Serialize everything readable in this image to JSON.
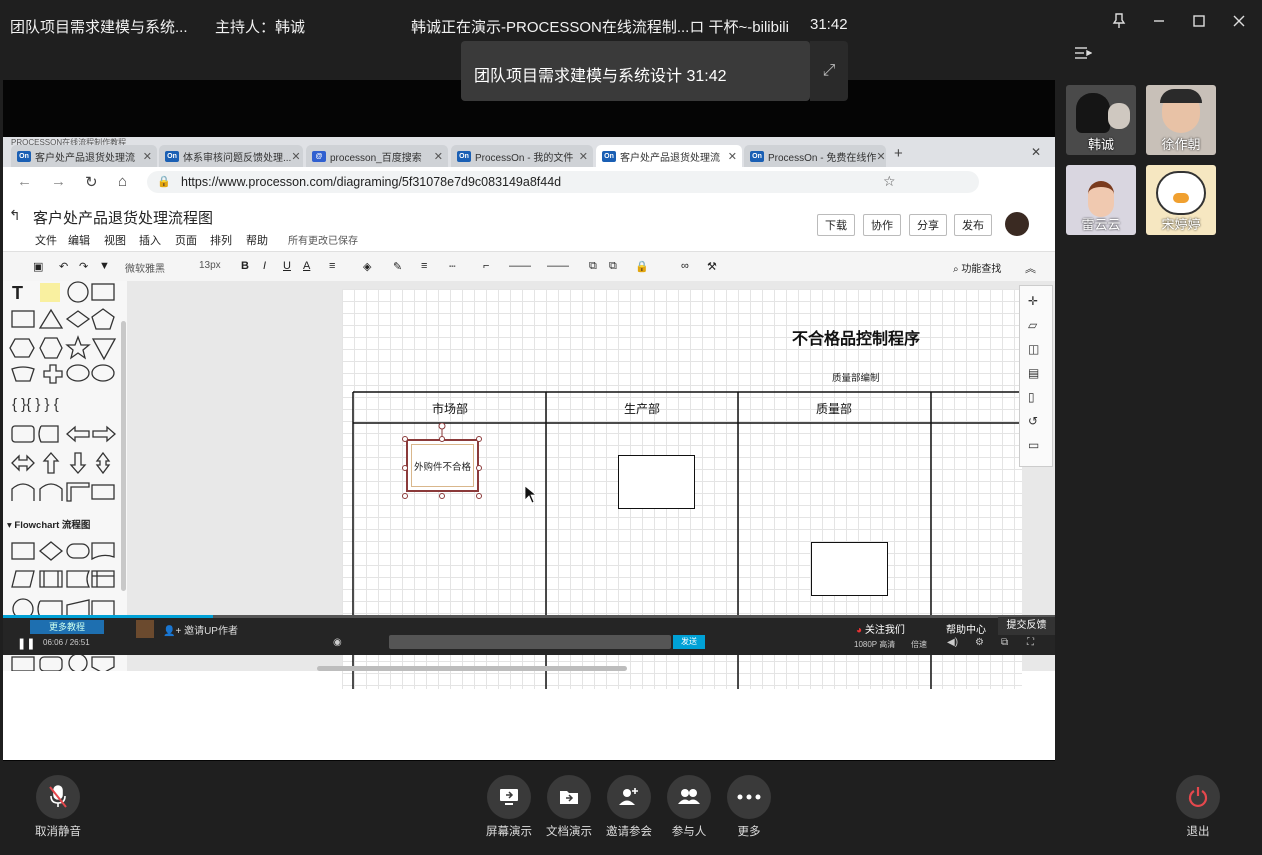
{
  "titlebar": {
    "meeting_title": "团队项目需求建模与系统...",
    "host": "主持人：韩诚",
    "presenting": "韩诚正在演示-PROCESSON在线流程制...ロ 干杯~-bilibili",
    "timer": "31:42"
  },
  "tooltip": {
    "text": "团队项目需求建模与系统设计  31:42"
  },
  "browser": {
    "window_label": "PROCESSON在线流程制作教程",
    "tabs": [
      {
        "icon": "On",
        "label": "客户处产品退货处理流"
      },
      {
        "icon": "On",
        "label": "体系审核问题反馈处理..."
      },
      {
        "icon": "@",
        "label": "processon_百度搜索"
      },
      {
        "icon": "On",
        "label": "ProcessOn - 我的文件"
      },
      {
        "icon": "On",
        "label": "客户处产品退货处理流"
      },
      {
        "icon": "On",
        "label": "ProcessOn - 免费在线作"
      }
    ],
    "url": "https://www.processon.com/diagraming/5f31078e7d9c083149a8f44d"
  },
  "app": {
    "doc_title": "客户处产品退货处理流程图",
    "menu": [
      "文件",
      "编辑",
      "视图",
      "插入",
      "页面",
      "排列",
      "帮助"
    ],
    "saved": "所有更改已保存",
    "buttons": {
      "download": "下载",
      "collab": "协作",
      "share": "分享",
      "publish": "发布"
    },
    "font": "微软雅黑",
    "size": "13px",
    "search": "功能查找",
    "flowchart_section": "Flowchart 流程图"
  },
  "diagram": {
    "title": "不合格品控制程序",
    "subtitle": "质量部编制",
    "lanes": [
      "市场部",
      "生产部",
      "质量部"
    ],
    "selected_box": "外购件不合格"
  },
  "video": {
    "progress_time": "06:06 / 26:51",
    "popup": "更多教程",
    "follow": "关注我们",
    "help": "帮助中心",
    "feedback": "提交反馈",
    "send": "发送",
    "quality": "1080P 高清",
    "speed": "倍速",
    "uploader": "邀请UP作者"
  },
  "participants": [
    {
      "name": "韩诚",
      "color": "#4a4a4a"
    },
    {
      "name": "徐作朝",
      "color": "#c8c0b8"
    },
    {
      "name": "雷云云",
      "color": "#d9d6e0"
    },
    {
      "name": "宋婷婷",
      "color": "#f6e7c1"
    }
  ],
  "controls": {
    "mute": "取消静音",
    "screen_share": "屏幕演示",
    "doc_share": "文档演示",
    "invite": "邀请参会",
    "participants": "参与人",
    "more": "更多",
    "leave": "退出"
  },
  "colors": {
    "background": "#1f1f1f",
    "leave": "#e5484d",
    "accent": "#1a5fb4"
  }
}
